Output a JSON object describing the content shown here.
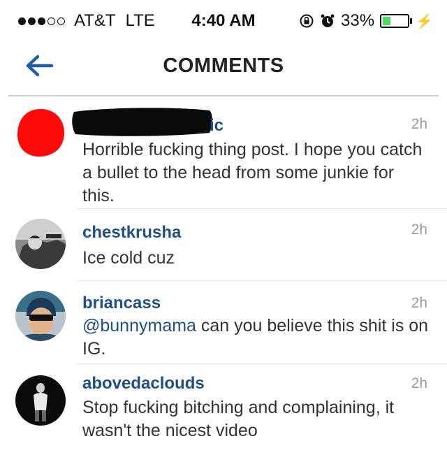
{
  "status": {
    "carrier": "AT&T",
    "network": "LTE",
    "time": "4:40 AM",
    "battery": "33%",
    "battery_level": 0.33,
    "battery_color": "#4cd964"
  },
  "nav": {
    "back_icon": "arrow-left-icon",
    "title": "COMMENTS"
  },
  "colors": {
    "username": "#1f4f85",
    "accent": "#1f5fa8"
  },
  "comments": [
    {
      "username": "ic",
      "time": "2h",
      "text": "Horrible fucking thing post. I hope you catch a bullet to the head from some junkie for this."
    },
    {
      "username": "chestkrusha",
      "time": "2h",
      "text": "Ice cold cuz"
    },
    {
      "username": "briancass",
      "time": "2h",
      "mention": "@bunnymama",
      "text": " can you believe this shit is on IG."
    },
    {
      "username": "abovedaclouds",
      "time": "2h",
      "text": "Stop fucking bitching and complaining, it wasn't the nicest video"
    }
  ]
}
